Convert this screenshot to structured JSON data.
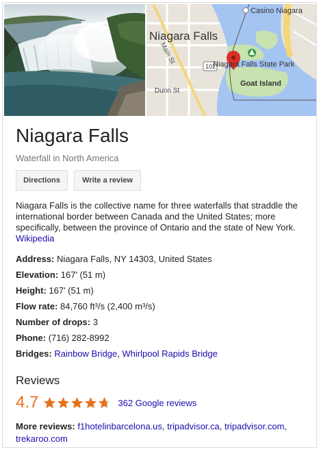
{
  "place": {
    "title": "Niagara Falls",
    "subtitle": "Waterfall in North America"
  },
  "actions": {
    "directions_label": "Directions",
    "review_label": "Write a review"
  },
  "description": {
    "text": "Niagara Falls is the collective name for three waterfalls that straddle the international border between Canada and the United States; more specifically, between the province of Ontario and the state of New York.",
    "source_label": "Wikipedia"
  },
  "map": {
    "labels": {
      "city": "Niagara Falls",
      "casino": "Casino Niagara",
      "main_st": "Main St",
      "route": "102",
      "park": "Niagara Falls State Park",
      "island": "Goat Island",
      "dunn_st": "Dunn St"
    },
    "marker_color": "#d93025"
  },
  "facts": [
    {
      "label": "Address:",
      "value": "Niagara Falls, NY 14303, United States",
      "linked": false
    },
    {
      "label": "Elevation:",
      "value": "167′ (51 m)",
      "linked": false
    },
    {
      "label": "Height:",
      "value": "167′ (51 m)",
      "linked": false
    },
    {
      "label": "Flow rate:",
      "value": "84,760 ft³/s (2,400 m³/s)",
      "linked": false
    },
    {
      "label": "Number of drops:",
      "value": "3",
      "linked": false
    },
    {
      "label": "Phone:",
      "value": "(716) 282-8992",
      "linked": false
    }
  ],
  "bridges": {
    "label": "Bridges:",
    "items": [
      "Rainbow Bridge",
      "Whirlpool Rapids Bridge"
    ],
    "separator": ", "
  },
  "reviews": {
    "heading": "Reviews",
    "rating": "4.7",
    "rating_value": 4.7,
    "star_color": "#e7711b",
    "count_label": "362 Google reviews",
    "more_label": "More reviews:",
    "more_links": [
      "f1hotelinbarcelona.us",
      "tripadvisor.ca",
      "tripadvisor.com",
      "trekaroo.com"
    ]
  }
}
